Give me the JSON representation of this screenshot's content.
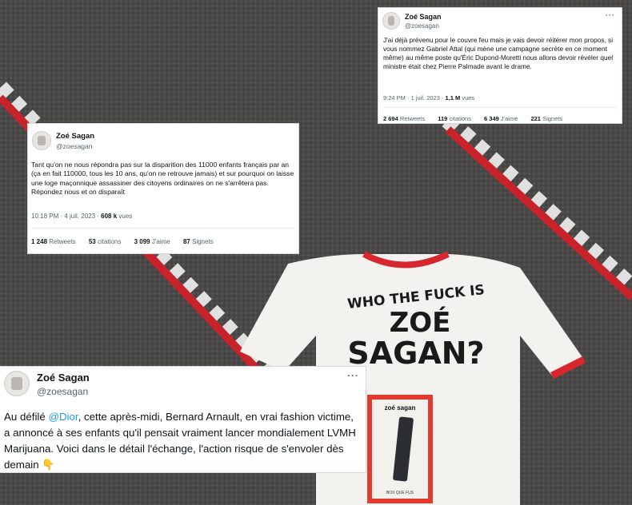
{
  "background": {
    "carpet_color": "#4a4846",
    "shirt_text": {
      "line1": "WHO THE FUCK IS",
      "line2": "ZOÉ",
      "line3": "SAGAN?"
    },
    "box_label": "zoé sagan",
    "box_footer": "BOX QUE FUS"
  },
  "tweet_top_right": {
    "name": "Zoé Sagan",
    "handle": "@zoesagan",
    "text": "J'ai déjà prévenu pour le couvre feu mais je vais devoir réitérer mon propos, si vous nommez Gabriel Attal (qui mène une campagne secrète en ce moment même) au même poste qu'Éric Dupond-Moretti nous allons devoir révéler quel ministre était chez Pierre Palmade avant le drame.",
    "time": "9:24 PM · 1 juil. 2023 · ",
    "views": "1,1 M",
    "views_label": " vues",
    "stats": [
      {
        "num": "2 694",
        "label": "Retweets"
      },
      {
        "num": "119",
        "label": "citations"
      },
      {
        "num": "6 349",
        "label": "J'aime"
      },
      {
        "num": "221",
        "label": "Signets"
      }
    ]
  },
  "tweet_left": {
    "name": "Zoé Sagan",
    "handle": "@zoesagan",
    "text": "Tant qu'on ne nous répondra pas sur la disparition des 11000 enfants français par an (ça en fait 110000, tous les 10 ans, qu'on ne retrouve jamais) et sur pourquoi on laisse une loge maçonnique assassiner des citoyens ordinaires on ne s'arrêtera pas. Répondez nous et on disparaît",
    "time": "10:18 PM · 4 juil. 2023 · ",
    "views": "608 k",
    "views_label": " vues",
    "stats": [
      {
        "num": "1 248",
        "label": "Retweets"
      },
      {
        "num": "53",
        "label": "citations"
      },
      {
        "num": "3 099",
        "label": "J'aime"
      },
      {
        "num": "87",
        "label": "Signets"
      }
    ]
  },
  "tweet_bottom": {
    "name": "Zoé Sagan",
    "handle": "@zoesagan",
    "text_before": "Au défilé ",
    "mention": "@Dior",
    "text_after": ", cette après-midi, Bernard Arnault, en vrai fashion victime, a annoncé à ses enfants qu'il pensait vraiment lancer mondialement LVMH Marijuana. Voici dans le détail l'échange, l'action risque de s'envoler dès demain 👇"
  },
  "more_icon": "···"
}
